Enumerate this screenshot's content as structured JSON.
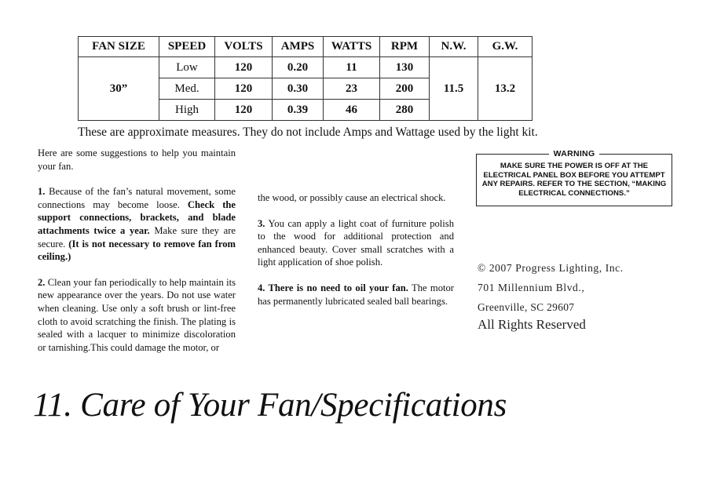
{
  "spec_table": {
    "headers": [
      "FAN SIZE",
      "SPEED",
      "VOLTS",
      "AMPS",
      "WATTS",
      "RPM",
      "N.W.",
      "G.W."
    ],
    "fan_size": "30”",
    "rows": [
      {
        "speed": "Low",
        "volts": "120",
        "amps": "0.20",
        "watts": "11",
        "rpm": "130"
      },
      {
        "speed": "Med.",
        "volts": "120",
        "amps": "0.30",
        "watts": "23",
        "rpm": "200"
      },
      {
        "speed": "High",
        "volts": "120",
        "amps": "0.39",
        "watts": "46",
        "rpm": "280"
      }
    ],
    "net_weight": "11.5",
    "gross_weight": "13.2",
    "note": "These are approximate measures. They do not include Amps and Wattage used by the light kit."
  },
  "care": {
    "intro": "Here are some suggestions to help you maintain your fan.",
    "item1": {
      "num": "1.",
      "text_a": " Because of the fan’s natural movement, some connections may become loose. ",
      "bold_a": "Check the support connections, brackets, and blade attachments twice a year.",
      "text_b": " Make sure they are secure. ",
      "bold_b": "(It is not necessary to remove fan from ceiling.)"
    },
    "item2": {
      "num": "2.",
      "text": " Clean your fan periodically to help maintain its new appearance over the years. Do not use water when cleaning.  Use only a soft brush or lint-free cloth to avoid scratching the finish.  The plating is sealed with a lacquer to minimize discoloration or tarnishing.This could damage the motor, or",
      "continued": "the wood, or possibly cause an electrical shock."
    },
    "item3": {
      "num": "3.",
      "text": " You can apply a light coat of furniture polish to the wood for additional protection and enhanced beauty. Cover small scratches with a light application of shoe polish."
    },
    "item4": {
      "bold": "4. There is no need to oil your fan.",
      "text": " The motor has permanently lubricated sealed ball bearings."
    }
  },
  "warning": {
    "title": "WARNING",
    "body": "MAKE SURE THE POWER IS OFF AT THE ELECTRICAL PANEL BOX BEFORE YOU ATTEMPT ANY REPAIRS. REFER TO THE SECTION, “MAKING ELECTRICAL CONNECTIONS.”"
  },
  "copyright": {
    "line1": "© 2007 Progress Lighting, Inc.",
    "line2": "701 Millennium Blvd.,",
    "line3": "Greenville, SC 29607",
    "line4": "All Rights Reserved"
  },
  "page_title": "11. Care of Your Fan/Specifications"
}
